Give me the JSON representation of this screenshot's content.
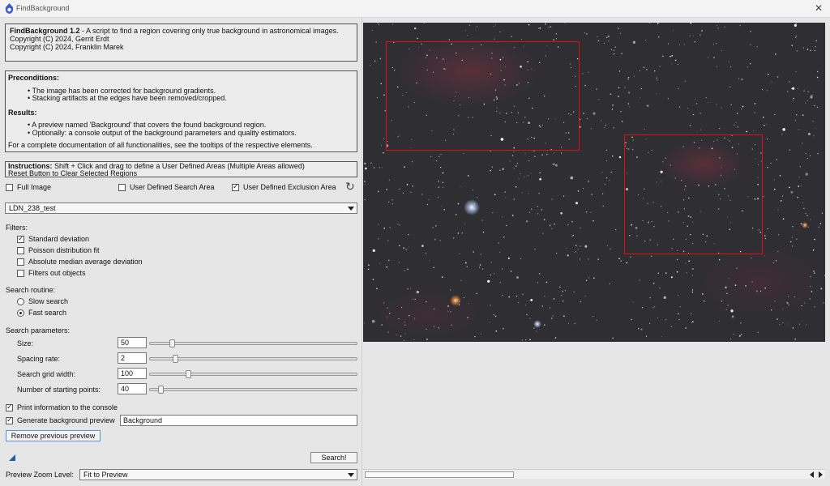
{
  "window": {
    "title": "FindBackground",
    "close": "✕"
  },
  "about": {
    "name": "FindBackground 1.2",
    "description": " - A script to find a region covering only true background in astronomical images.",
    "copyright_1": "Copyright (C) 2024, Gerrit Erdt",
    "copyright_2": "Copyright (C) 2024, Franklin Marek"
  },
  "info": {
    "preconditions_title": "Preconditions:",
    "preconditions": [
      "• The image has been corrected for background gradients.",
      "• Stacking artifacts at the edges have been removed/cropped."
    ],
    "results_title": "Results:",
    "results": [
      "• A preview named 'Background' that covers the found background region.",
      "• Optionally: a console output of the background parameters and quality estimators."
    ],
    "doc_note": "For a complete documentation of all functionalities, see the tooltips of the respective elements."
  },
  "instructions": {
    "label": "Instructions:",
    "line1": " Shift + Click and drag to define a User Defined Areas (Multiple Areas allowed)",
    "line2": "Reset Button to Clear Selected Regions"
  },
  "area_mode": {
    "full_image": {
      "label": "Full Image",
      "checked": false
    },
    "search_area": {
      "label": "User Defined Search Area",
      "checked": false
    },
    "exclusion_area": {
      "label": "User Defined Exclusion Area",
      "checked": true
    },
    "reset_icon": "reset-icon"
  },
  "image_select": {
    "value": "LDN_238_test"
  },
  "filters": {
    "title": "Filters:",
    "items": [
      {
        "label": "Standard deviation",
        "checked": true
      },
      {
        "label": "Poisson distribution fit",
        "checked": false
      },
      {
        "label": "Absolute median average deviation",
        "checked": false
      },
      {
        "label": "Filters out objects",
        "checked": false
      }
    ]
  },
  "search_routine": {
    "title": "Search routine:",
    "options": [
      {
        "label": "Slow search",
        "selected": false
      },
      {
        "label": "Fast search",
        "selected": true
      }
    ]
  },
  "search_params": {
    "title": "Search parameters:",
    "size": {
      "label": "Size:",
      "value": "50",
      "slider_fraction": 0.1
    },
    "spacing": {
      "label": "Spacing rate:",
      "value": "2",
      "slider_fraction": 0.12
    },
    "grid_width": {
      "label": "Search grid width:",
      "value": "100",
      "slider_fraction": 0.18
    },
    "starting_points": {
      "label": "Number of starting points:",
      "value": "40",
      "slider_fraction": 0.05
    }
  },
  "output": {
    "print_console": {
      "label": "Print information to the console",
      "checked": true
    },
    "gen_preview": {
      "label": "Generate background preview",
      "checked": true,
      "name_value": "Background"
    },
    "remove_button": "Remove previous preview"
  },
  "search_button": "Search!",
  "zoom": {
    "label": "Preview Zoom Level:",
    "value": "Fit to Preview"
  }
}
